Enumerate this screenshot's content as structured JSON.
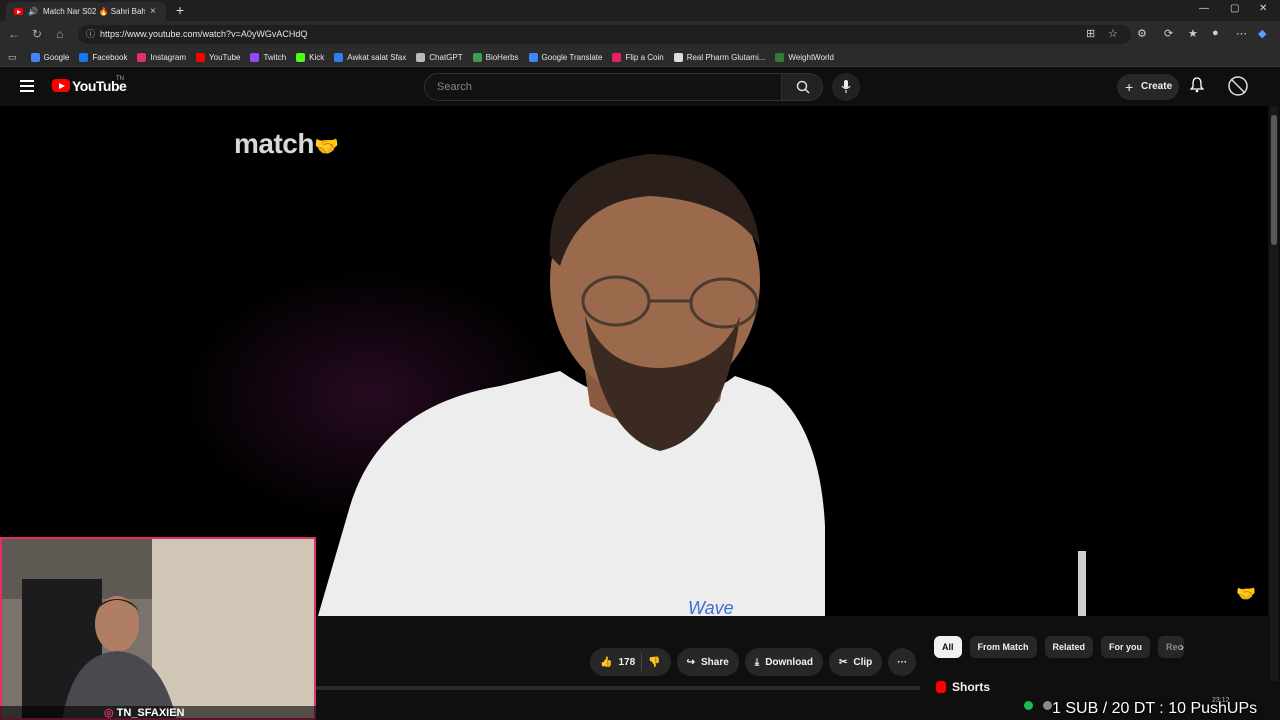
{
  "browser": {
    "tab_title": "Match Nar S02 🔥 Sahri Bahr...",
    "new_tab": "+",
    "url": "https://www.youtube.com/watch?v=A0yWGvACHdQ",
    "window_controls": [
      "—",
      "▢",
      "✕"
    ]
  },
  "bookmarks": [
    {
      "label": "Google",
      "color": "#4285f4"
    },
    {
      "label": "Facebook",
      "color": "#1877f2"
    },
    {
      "label": "Instagram",
      "color": "#e1306c"
    },
    {
      "label": "YouTube",
      "color": "#ff0000"
    },
    {
      "label": "Twitch",
      "color": "#9146ff"
    },
    {
      "label": "Kick",
      "color": "#53fc18"
    },
    {
      "label": "Awkat salat Sfax",
      "color": "#2f80ed"
    },
    {
      "label": "ChatGPT",
      "color": "#bbbbbb"
    },
    {
      "label": "BioHerbs",
      "color": "#3a9d4f"
    },
    {
      "label": "Google Translate",
      "color": "#4285f4"
    },
    {
      "label": "Flip a Coin",
      "color": "#e91e63"
    },
    {
      "label": "Real Pharm Glutami...",
      "color": "#dddddd"
    },
    {
      "label": "WeightWorld",
      "color": "#2e7d32"
    }
  ],
  "youtube": {
    "logo_text": "YouTube",
    "country_code": "TN",
    "search_placeholder": "Search",
    "create_label": "Create"
  },
  "video": {
    "channel_watermark": "match"
  },
  "actions": {
    "likes": "178",
    "share": "Share",
    "download": "Download",
    "clip": "Clip",
    "more": "···"
  },
  "chips": [
    "All",
    "From Match",
    "Related",
    "For you",
    "Rec"
  ],
  "shorts_label": "Shorts",
  "stream_overlay": {
    "webcam_tag": "TN_SFAXIEN",
    "goal_text": "1 SUB / 20 DT : 10 PushUPs",
    "clock": "23:12"
  },
  "colors": {
    "accent": "#ff0000",
    "background": "#0f0f0f",
    "webcam_border": "#e2306c"
  }
}
